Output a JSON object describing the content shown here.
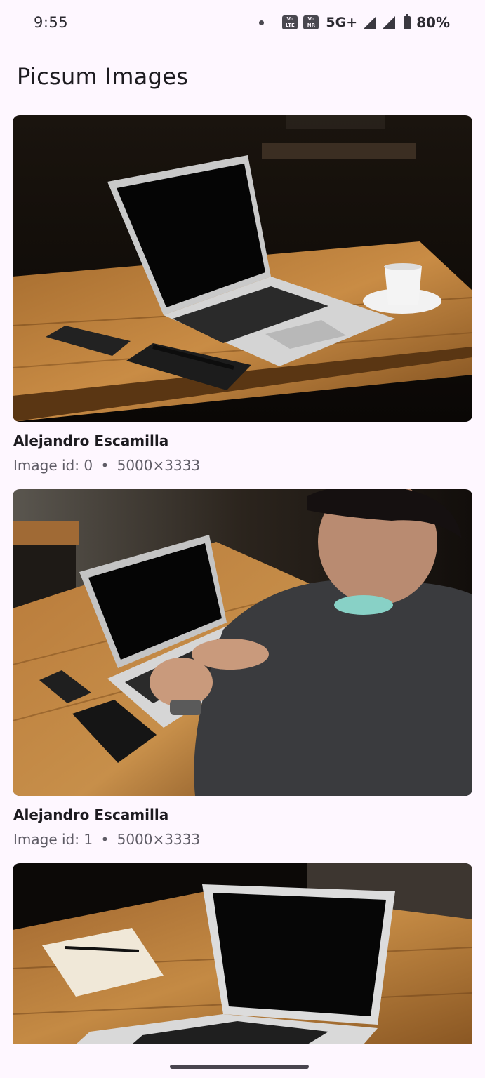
{
  "status_bar": {
    "time": "9:55",
    "volte1_top": "Vo",
    "volte1_bottom": "LTE",
    "volte2_top": "Vo",
    "volte2_bottom": "NR",
    "network": "5G+",
    "battery": "80%"
  },
  "header": {
    "title": "Picsum Images"
  },
  "images": [
    {
      "author": "Alejandro Escamilla",
      "id_label": "Image id: 0",
      "separator": "•",
      "dimensions": "5000×3333"
    },
    {
      "author": "Alejandro Escamilla",
      "id_label": "Image id: 1",
      "separator": "•",
      "dimensions": "5000×3333"
    },
    {
      "author": "",
      "id_label": "",
      "separator": "",
      "dimensions": ""
    }
  ],
  "colors": {
    "background": "#fef7ff",
    "title_text": "#1d1b20",
    "meta_text": "#5f5c66"
  }
}
